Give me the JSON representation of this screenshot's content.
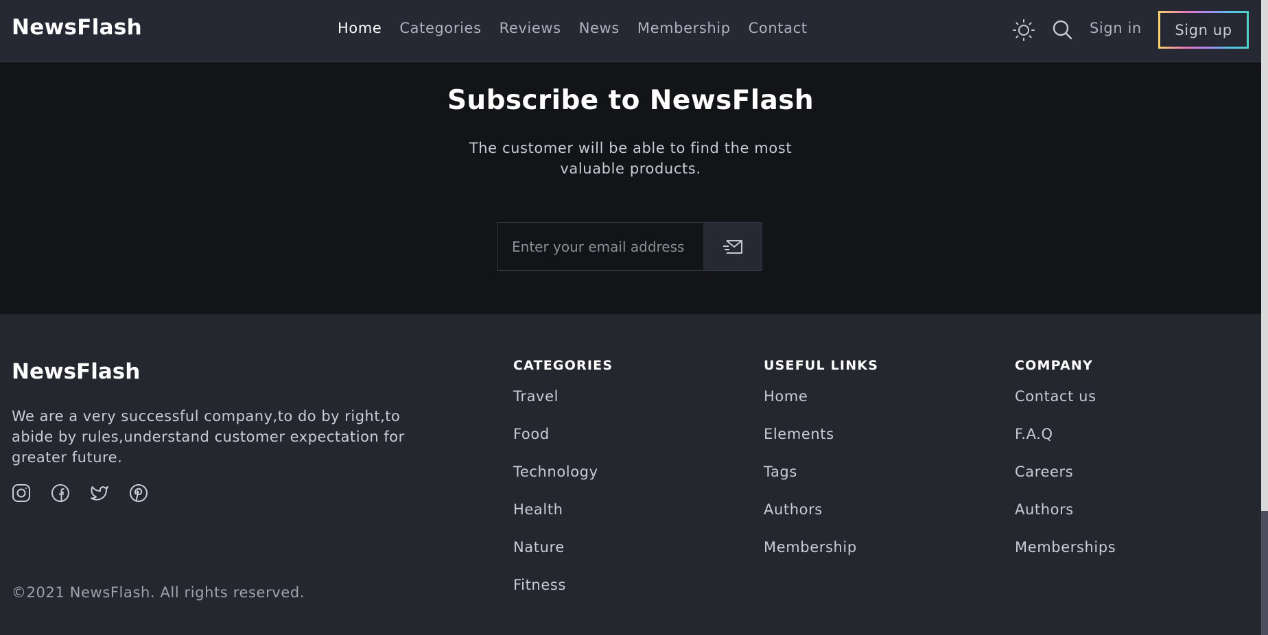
{
  "navbar": {
    "brand": "NewsFlash",
    "links": [
      "Home",
      "Categories",
      "Reviews",
      "News",
      "Membership",
      "Contact"
    ],
    "sign_in": "Sign in",
    "sign_up": "Sign up",
    "icons": {
      "theme": "sun-icon",
      "search": "search-icon"
    }
  },
  "subscribe": {
    "title": "Subscribe to NewsFlash",
    "text": "The customer will be able to find the most valuable products.",
    "email_placeholder": "Enter your email address",
    "send_icon": "mail-send-icon"
  },
  "footer": {
    "brand": "NewsFlash",
    "about": "We are a very successful company,to do by right,to abide by rules,understand customer expectation for greater future.",
    "socials": [
      "instagram-icon",
      "facebook-icon",
      "twitter-icon",
      "pinterest-icon"
    ],
    "copyright": "©2021 NewsFlash. All rights reserved.",
    "columns": [
      {
        "title": "CATEGORIES",
        "items": [
          "Travel",
          "Food",
          "Technology",
          "Health",
          "Nature",
          "Fitness"
        ]
      },
      {
        "title": "USEFUL LINKS",
        "items": [
          "Home",
          "Elements",
          "Tags",
          "Authors",
          "Membership"
        ]
      },
      {
        "title": "COMPANY",
        "items": [
          "Contact us",
          "F.A.Q",
          "Careers",
          "Authors",
          "Memberships"
        ]
      }
    ]
  },
  "colors": {
    "background": "#25272f",
    "subscribe_bg": "#131417",
    "heading": "#ffffff",
    "text": "#c9ccd6",
    "signup_gradient": [
      "#f4d36b",
      "#ee7bb8",
      "#a988f2",
      "#56c5e8",
      "#4fd1c5"
    ]
  }
}
